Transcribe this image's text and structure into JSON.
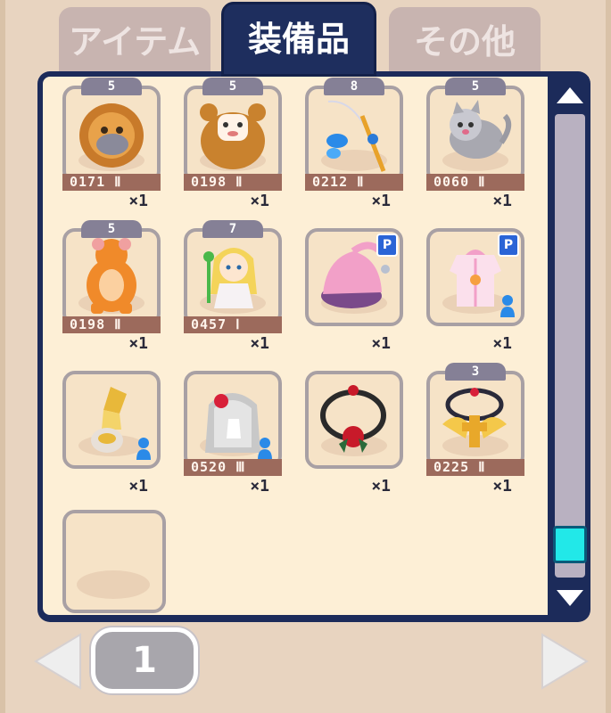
{
  "tabs": [
    {
      "label": "アイテム",
      "active": false
    },
    {
      "label": "装備品",
      "active": true
    },
    {
      "label": "その他",
      "active": false
    }
  ],
  "items": [
    {
      "level": "5",
      "code": "0171 Ⅱ",
      "qty": "×1",
      "icon": "lion-pet-icon"
    },
    {
      "level": "5",
      "code": "0198 Ⅱ",
      "qty": "×1",
      "icon": "bear-costume-icon"
    },
    {
      "level": "8",
      "code": "0212 Ⅱ",
      "qty": "×1",
      "icon": "fishing-rod-icon"
    },
    {
      "level": "5",
      "code": "0060 Ⅱ",
      "qty": "×1",
      "icon": "gray-cat-pet-icon"
    },
    {
      "level": "5",
      "code": "0198 Ⅱ",
      "qty": "×1",
      "icon": "orange-bear-suit-icon"
    },
    {
      "level": "7",
      "code": "0457 Ⅰ",
      "qty": "×1",
      "icon": "blonde-girl-pet-icon"
    },
    {
      "level": "",
      "code": "",
      "qty": "×1",
      "icon": "pink-hat-icon",
      "badge": "P"
    },
    {
      "level": "",
      "code": "",
      "qty": "×1",
      "icon": "pink-coat-icon",
      "badge": "P",
      "figure": true
    },
    {
      "level": "",
      "code": "",
      "qty": "×1",
      "icon": "gold-gauntlet-icon",
      "figure": true
    },
    {
      "level": "",
      "code": "0520 Ⅲ",
      "qty": "×1",
      "icon": "white-veil-icon",
      "figure": true
    },
    {
      "level": "",
      "code": "",
      "qty": "×1",
      "icon": "rose-necklace-icon"
    },
    {
      "level": "3",
      "code": "0225 Ⅱ",
      "qty": "×1",
      "icon": "golden-cross-necklace-icon"
    }
  ],
  "pagination": {
    "current_page": "1"
  },
  "scroll": {
    "position": 0.9
  },
  "colors": {
    "panel": "#1c2b5a",
    "slot_bg": "#f6e3c7",
    "slot_border": "#a8a0a4",
    "code_strip": "#9c6a5c",
    "level_pill": "#858096",
    "scroll_thumb": "#22e8e8"
  }
}
